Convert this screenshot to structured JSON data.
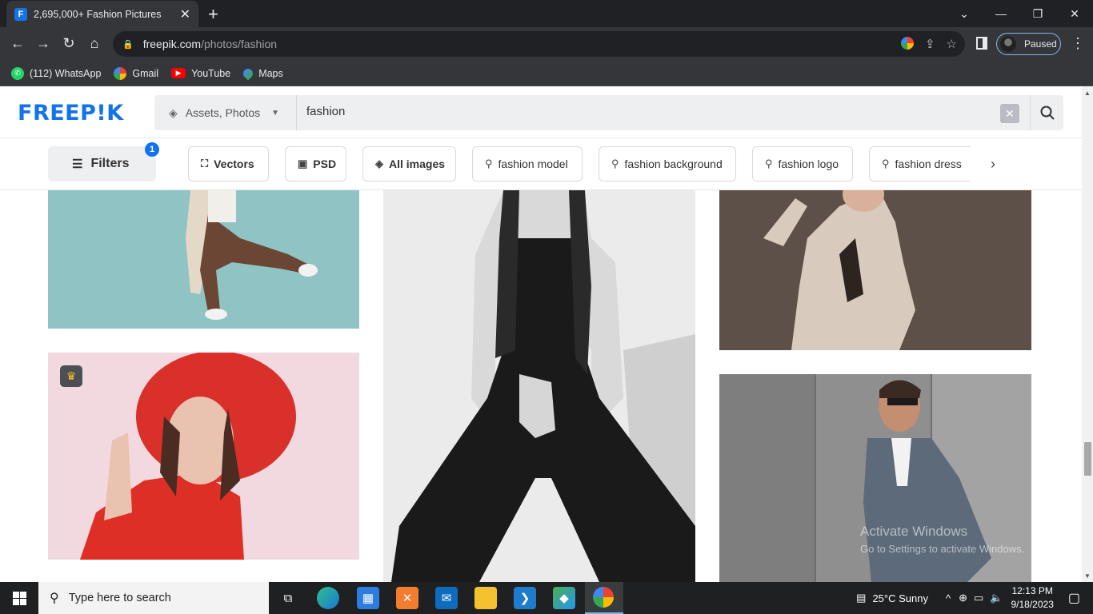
{
  "browser": {
    "tab_title": "2,695,000+ Fashion Pictures",
    "url_domain": "freepik.com",
    "url_path": "/photos/fashion",
    "profile_status": "Paused"
  },
  "bookmarks": [
    {
      "label": "(112) WhatsApp",
      "icon": "whatsapp-icon",
      "color": "#25d366"
    },
    {
      "label": "Gmail",
      "icon": "google-icon",
      "color": "#ea4335"
    },
    {
      "label": "YouTube",
      "icon": "youtube-icon",
      "color": "#ff0000"
    },
    {
      "label": "Maps",
      "icon": "maps-icon",
      "color": "#34a853"
    }
  ],
  "site": {
    "logo": "FREEP!K",
    "brand_color": "#1273eb",
    "search": {
      "asset_type": "Assets, Photos",
      "query": "fashion"
    },
    "filters": {
      "label": "Filters",
      "count": "1"
    },
    "chips": [
      "Vectors",
      "PSD",
      "All images",
      "fashion model",
      "fashion background",
      "fashion logo",
      "fashion dress"
    ]
  },
  "gallery": {
    "premium_icon": "crown-icon"
  },
  "os": {
    "activation_title": "Activate Windows",
    "activation_subtitle": "Go to Settings to activate Windows.",
    "search_placeholder": "Type here to search",
    "weather": "25°C  Sunny",
    "time": "12:13 PM",
    "date": "9/18/2023"
  }
}
